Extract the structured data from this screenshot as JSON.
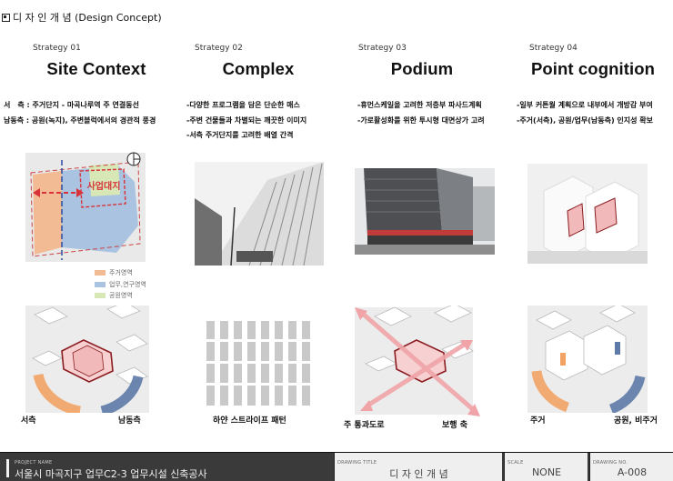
{
  "sheet_title": "디 자 인 개 념 (Design Concept)",
  "strategies": [
    {
      "number": "Strategy 01",
      "title": "Site Context",
      "desc": [
        "서　측 : 주거단지 - 마곡나루역 주 연결동선",
        "남동측 : 공원(녹지), 주변블럭에서의 경관적 풍경"
      ],
      "caption_left": "서측",
      "caption_right": "남동측",
      "map_label": "사업대지",
      "legend": [
        "주거영역",
        "업무,연구영역",
        "공원영역"
      ]
    },
    {
      "number": "Strategy 02",
      "title": "Complex",
      "desc": [
        "-다양한 프로그램을 담은 단순한 매스",
        "-주변 건물들과 차별되는 깨끗한 이미지",
        "-서측 주거단지를 고려한 배열 간격"
      ],
      "caption_center": "하얀 스트라이프 패턴"
    },
    {
      "number": "Strategy 03",
      "title": "Podium",
      "desc": [
        "-휴먼스케일을 고려한 저층부 파사드계획",
        "-가로활성화를 위한 투시형 대면상가 고려"
      ],
      "caption_left": "주 통과도로",
      "caption_right": "보행 축"
    },
    {
      "number": "Strategy 04",
      "title": "Point cognition",
      "desc": [
        "-일부 커튼월 계획으로 내부에서 개방감 부여",
        "-주거(서측), 공원/업무(남동측) 인지성 확보"
      ],
      "caption_left": "주거",
      "caption_right": "공원, 비주거"
    }
  ],
  "footer": {
    "project_label": "PROJECT NAME",
    "project_value": "서울시 마곡지구 업무C2-3 업무시설 신축공사",
    "drawing_title_label": "DRAWING TITLE",
    "drawing_title_value": "디 자 인 개 념",
    "scale_label": "SCALE",
    "scale_value": "NONE",
    "drawing_no_label": "DRAWING NO.",
    "drawing_no_value": "A-008"
  },
  "colors": {
    "residential": "#f0b487",
    "office": "#a9c1de",
    "park": "#d5e6b4",
    "accent_red": "#d8323a",
    "pink": "#f0a4a8"
  }
}
